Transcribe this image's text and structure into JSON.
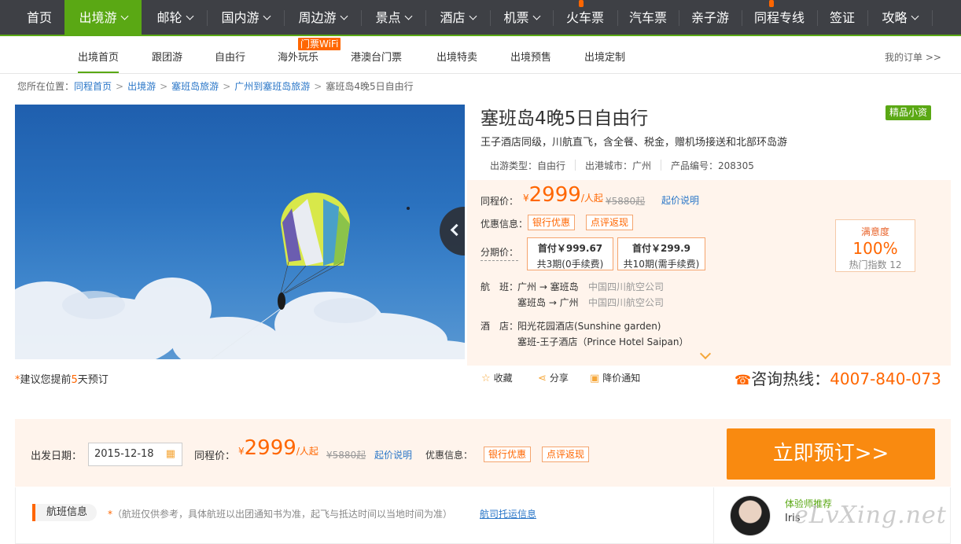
{
  "topnav": {
    "items": [
      {
        "label": "首页",
        "dropdown": false
      },
      {
        "label": "出境游",
        "dropdown": true,
        "active": true
      },
      {
        "label": "邮轮",
        "dropdown": true
      },
      {
        "label": "国内游",
        "dropdown": true
      },
      {
        "label": "周边游",
        "dropdown": true
      },
      {
        "label": "景点",
        "dropdown": true
      },
      {
        "label": "酒店",
        "dropdown": true
      },
      {
        "label": "机票",
        "dropdown": true
      },
      {
        "label": "火车票",
        "dropdown": true
      },
      {
        "label": "汽车票",
        "dropdown": false
      },
      {
        "label": "亲子游",
        "dropdown": false
      },
      {
        "label": "同程专线",
        "dropdown": false
      },
      {
        "label": "签证",
        "dropdown": false
      },
      {
        "label": "攻略",
        "dropdown": true
      }
    ],
    "active_color": "#5aa814"
  },
  "subnav": {
    "items": [
      "出境首页",
      "跟团游",
      "自由行",
      "海外玩乐",
      "港澳台门票",
      "出境特卖",
      "出境预售",
      "出境定制"
    ],
    "wifi_badge": "门票WiFi",
    "my_orders": "我的订单 >>"
  },
  "breadcrumb": {
    "prefix": "您所在位置：",
    "links": [
      "同程首页",
      "出境游",
      "塞班岛旅游",
      "广州到塞班岛旅游"
    ],
    "current": "塞班岛4晚5日自由行",
    "separator": ">"
  },
  "product": {
    "title": "塞班岛4晚5日自由行",
    "badge": "精品小资",
    "subtitle": "王子酒店同级，川航直飞，含全餐、税金，赠机场接送和北部环岛游",
    "meta": {
      "type": "出游类型：自由行",
      "city": "出港城市：广州",
      "code": "产品编号：208305"
    }
  },
  "pricing": {
    "price_label": "同程价：",
    "currency": "¥",
    "price": "2999",
    "unit": "/人起",
    "original": "¥5880起",
    "explain_link": "起价说明",
    "discount_label": "优惠信息：",
    "discount_tags": [
      "银行优惠",
      "点评返现"
    ],
    "installment_label": "分期价：",
    "installments": [
      {
        "down": "首付￥999.67",
        "note": "共3期(0手续费)"
      },
      {
        "down": "首付￥299.9",
        "note": "共10期(需手续费)"
      }
    ],
    "satisfaction": {
      "title": "满意度",
      "value": "100%",
      "hot": "热门指数 12"
    },
    "flight_label": "航　班：",
    "flights": [
      {
        "route": "广州 → 塞班岛",
        "airline": "中国四川航空公司"
      },
      {
        "route": "塞班岛 → 广州",
        "airline": "中国四川航空公司"
      }
    ],
    "hotel_label": "酒　店：",
    "hotels": [
      "阳光花园酒店(Sunshine garden)",
      "塞班-王子酒店（Prince Hotel Saipan）"
    ]
  },
  "tip": {
    "star": "*",
    "before": "建议您提前",
    "days": "5",
    "after": "天预订"
  },
  "actions": {
    "favorite": "收藏",
    "share": "分享",
    "price_alert": "降价通知"
  },
  "hotline": {
    "label": "咨询热线：",
    "number": "4007-840-073"
  },
  "booking": {
    "date_label": "出发日期：",
    "date_value": "2015-12-18",
    "price_label": "同程价：",
    "currency": "¥",
    "price": "2999",
    "unit": "/人起",
    "original": "¥5880起",
    "explain_link": "起价说明",
    "discount_label": "优惠信息：",
    "discount_tags": [
      "银行优惠",
      "点评返现"
    ],
    "book_button": "立即预订>>"
  },
  "flight_section": {
    "tab": "航班信息",
    "note_star": "*",
    "note": "（航班仅供参考，具体航班以出团通知书为准，起飞与抵达时间以当地时间为准）",
    "checkin_link": "航司托运信息"
  },
  "recommend": {
    "title": "体验师推荐",
    "name": "Iris"
  },
  "watermark": "eLvXing.net"
}
